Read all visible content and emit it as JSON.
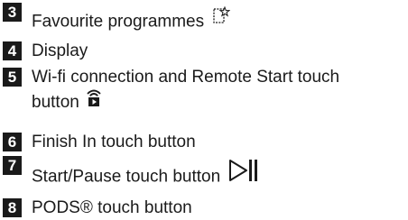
{
  "legend": {
    "items": [
      {
        "number": "3",
        "label": "Favourite programmes",
        "icon": "favourite-star-icon"
      },
      {
        "number": "4",
        "label": "Display"
      },
      {
        "number": "5",
        "label": "Wi-fi connection and Remote Start touch",
        "continuation": "button",
        "icon": "wifi-remote-start-icon"
      },
      {
        "number": "6",
        "label": "Finish In touch button"
      },
      {
        "number": "7",
        "label": "Start/Pause touch button",
        "icon": "start-pause-icon"
      },
      {
        "number": "8",
        "label": "PODS® touch button"
      }
    ]
  },
  "colors": {
    "text": "#1a1a1a",
    "badge_background": "#1a1a1a",
    "badge_text": "#ffffff",
    "background": "#ffffff"
  }
}
